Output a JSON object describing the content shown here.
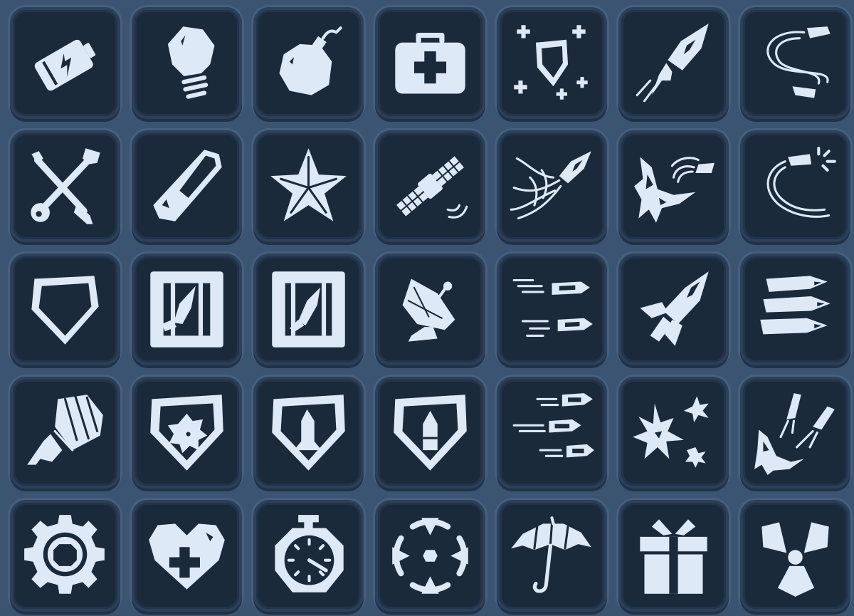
{
  "palette": {
    "background": "#3b5472",
    "tile": "#1b2a3b",
    "tile_border": "#2c4058",
    "icon": "#dde9f7"
  },
  "icons": [
    "battery-icon",
    "lightbulb-icon",
    "bomb-icon",
    "medkit-icon",
    "shield-sparkle-icon",
    "rocket-icon",
    "orbit-bullets-icon",
    "repair-tools-icon",
    "pill-icon",
    "star-icon",
    "satellite-icon",
    "rocket-smoke-icon",
    "rocket-impact-icon",
    "circling-bullet-icon",
    "shield-icon",
    "crate-bomb-icon",
    "crate-missile-icon",
    "radar-dish-icon",
    "twin-bullets-icon",
    "rocket-launch-icon",
    "triple-bullets-icon",
    "parachute-icon",
    "shield-burst-icon",
    "shield-missile-icon",
    "shield-bullet-icon",
    "bullet-barrage-icon",
    "explosions-icon",
    "missile-strike-icon",
    "gear-icon",
    "heart-health-icon",
    "stopwatch-icon",
    "crosshair-icon",
    "umbrella-icon",
    "gift-icon",
    "radiation-icon"
  ]
}
